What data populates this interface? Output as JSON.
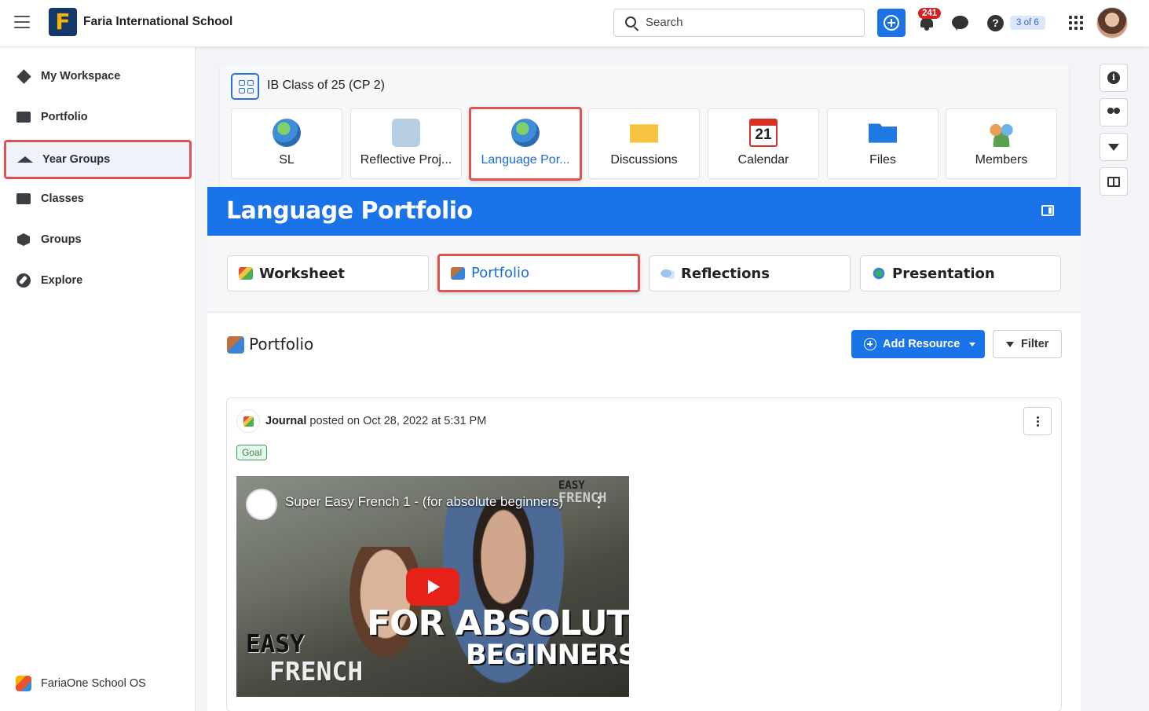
{
  "header": {
    "school_name": "Faria International School",
    "logo_letter": "F",
    "search_placeholder": "Search",
    "notification_count": "241",
    "page_indicator": "3 of 6"
  },
  "sidebar": {
    "items": [
      {
        "label": "My Workspace",
        "icon": "workspace-icon"
      },
      {
        "label": "Portfolio",
        "icon": "briefcase-icon"
      },
      {
        "label": "Year Groups",
        "icon": "graduation-cap-icon",
        "active": true
      },
      {
        "label": "Classes",
        "icon": "classes-icon"
      },
      {
        "label": "Groups",
        "icon": "cube-icon"
      },
      {
        "label": "Explore",
        "icon": "compass-icon"
      }
    ],
    "footer_label": "FariaOne School OS"
  },
  "class": {
    "title": "IB Class of 25 (CP 2)",
    "tiles": [
      {
        "label": "SL",
        "icon": "globe-icon"
      },
      {
        "label": "Reflective Proj...",
        "icon": "speech-bubble-icon"
      },
      {
        "label": "Language Por...",
        "icon": "globe-icon",
        "active": true
      },
      {
        "label": "Discussions",
        "icon": "envelope-icon"
      },
      {
        "label": "Calendar",
        "icon": "calendar-icon",
        "calendar_day": "21"
      },
      {
        "label": "Files",
        "icon": "folder-icon"
      },
      {
        "label": "Members",
        "icon": "members-icon"
      }
    ]
  },
  "banner": {
    "title": "Language Portfolio"
  },
  "subtabs": [
    {
      "label": "Worksheet",
      "icon": "worksheet-icon"
    },
    {
      "label": "Portfolio",
      "icon": "portfolio-icon",
      "active": true
    },
    {
      "label": "Reflections",
      "icon": "reflections-icon"
    },
    {
      "label": "Presentation",
      "icon": "presentation-icon"
    }
  ],
  "section": {
    "title": "Portfolio",
    "add_resource_label": "Add Resource",
    "filter_label": "Filter"
  },
  "post": {
    "author": "Journal",
    "meta": "posted on Oct 28, 2022 at 5:31 PM",
    "tag": "Goal",
    "video": {
      "title": "Super Easy French 1 - (for absolute beginners)",
      "brand_top": "EASY",
      "brand_bottom": "FRENCH",
      "overlay_line1": "FOR ABSOLUTE",
      "overlay_line2": "BEGINNERS",
      "corner_line1": "EASY",
      "corner_line2": "FRENCH"
    }
  },
  "colors": {
    "primary": "#1a73e8",
    "highlight_border": "#e05252",
    "notification_badge": "#d42020",
    "goal_tag": "#2e8a4d"
  }
}
